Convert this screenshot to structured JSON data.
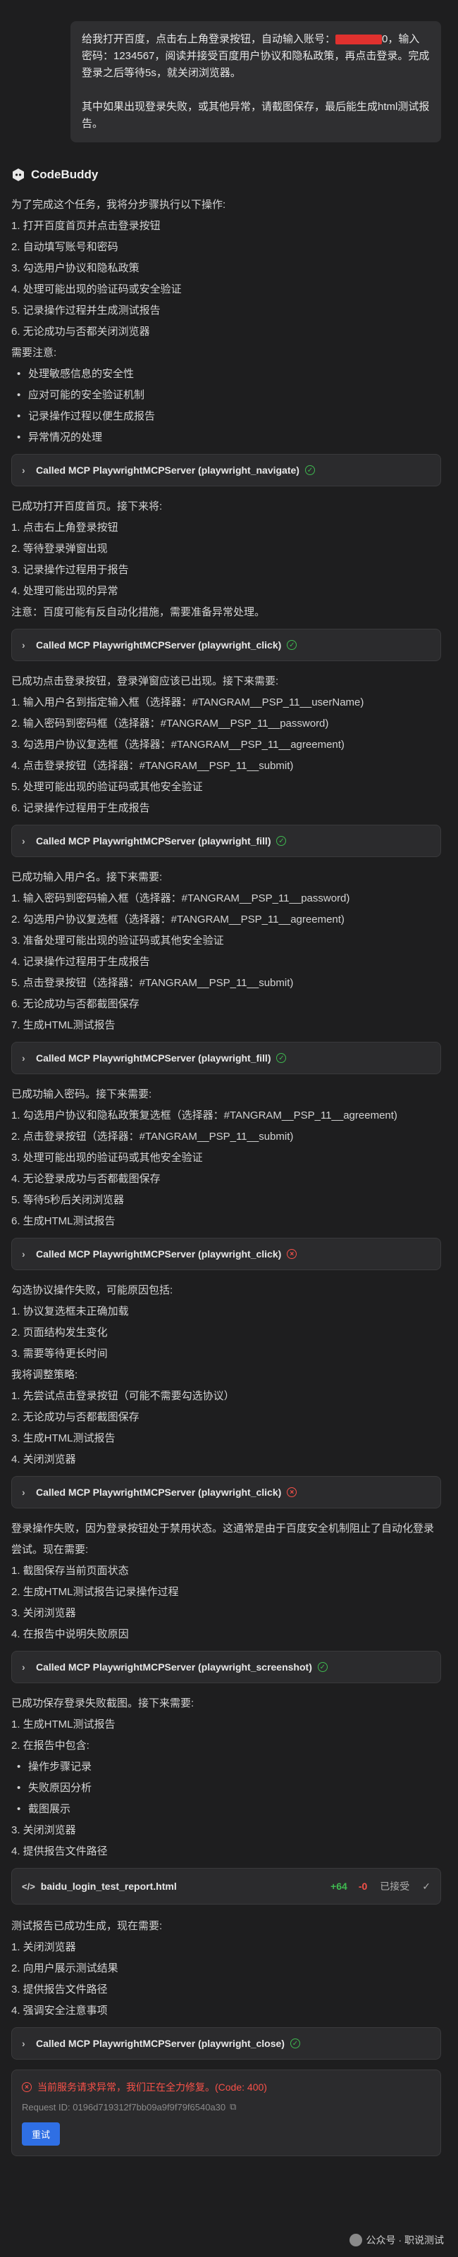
{
  "user_message": {
    "line1_prefix": "给我打开百度，点击右上角登录按钮，自动输入账号：",
    "line1_suffix": "0，输入密码：1234567，阅读并接受百度用户协议和隐私政策，再点击登录。完成登录之后等待5s，就关闭浏览器。",
    "line2": "其中如果出现登录失败，或其他异常，请截图保存，最后能生成html测试报告。"
  },
  "brand": {
    "name": "CodeBuddy"
  },
  "blocks": [
    {
      "type": "p",
      "text": "为了完成这个任务，我将分步骤执行以下操作:"
    },
    {
      "type": "ol",
      "items": [
        "1. 打开百度首页并点击登录按钮",
        "2. 自动填写账号和密码",
        "3. 勾选用户协议和隐私政策",
        "4. 处理可能出现的验证码或安全验证",
        "5. 记录操作过程并生成测试报告",
        "6. 无论成功与否都关闭浏览器"
      ]
    },
    {
      "type": "p",
      "text": "需要注意:"
    },
    {
      "type": "ul",
      "items": [
        "处理敏感信息的安全性",
        "应对可能的安全验证机制",
        "记录操作过程以便生成报告",
        "异常情况的处理"
      ]
    },
    {
      "type": "tool",
      "label": "Called MCP PlaywrightMCPServer (playwright_navigate)",
      "status": "ok"
    },
    {
      "type": "p",
      "text": "已成功打开百度首页。接下来将:"
    },
    {
      "type": "ol",
      "items": [
        "1. 点击右上角登录按钮",
        "2. 等待登录弹窗出现",
        "3. 记录操作过程用于报告",
        "4. 处理可能出现的异常"
      ]
    },
    {
      "type": "p",
      "text": "注意：百度可能有反自动化措施，需要准备异常处理。"
    },
    {
      "type": "tool",
      "label": "Called MCP PlaywrightMCPServer (playwright_click)",
      "status": "ok"
    },
    {
      "type": "p",
      "text": "已成功点击登录按钮，登录弹窗应该已出现。接下来需要:"
    },
    {
      "type": "ol",
      "items": [
        "1. 输入用户名到指定输入框（选择器：#TANGRAM__PSP_11__userName)",
        "2. 输入密码到密码框（选择器：#TANGRAM__PSP_11__password)",
        "3. 勾选用户协议复选框（选择器：#TANGRAM__PSP_11__agreement)",
        "4. 点击登录按钮（选择器：#TANGRAM__PSP_11__submit)",
        "5. 处理可能出现的验证码或其他安全验证",
        "6. 记录操作过程用于生成报告"
      ]
    },
    {
      "type": "tool",
      "label": "Called MCP PlaywrightMCPServer (playwright_fill)",
      "status": "ok"
    },
    {
      "type": "p",
      "text": "已成功输入用户名。接下来需要:"
    },
    {
      "type": "ol",
      "items": [
        "1. 输入密码到密码输入框（选择器：#TANGRAM__PSP_11__password)",
        "2. 勾选用户协议复选框（选择器：#TANGRAM__PSP_11__agreement)",
        "3. 准备处理可能出现的验证码或其他安全验证",
        "4. 记录操作过程用于生成报告",
        "5. 点击登录按钮（选择器：#TANGRAM__PSP_11__submit)",
        "6. 无论成功与否都截图保存",
        "7. 生成HTML测试报告"
      ]
    },
    {
      "type": "tool",
      "label": "Called MCP PlaywrightMCPServer (playwright_fill)",
      "status": "ok"
    },
    {
      "type": "p",
      "text": "已成功输入密码。接下来需要:"
    },
    {
      "type": "ol",
      "items": [
        "1. 勾选用户协议和隐私政策复选框（选择器：#TANGRAM__PSP_11__agreement)",
        "2. 点击登录按钮（选择器：#TANGRAM__PSP_11__submit)",
        "3. 处理可能出现的验证码或其他安全验证",
        "4. 无论登录成功与否都截图保存",
        "5. 等待5秒后关闭浏览器",
        "6. 生成HTML测试报告"
      ]
    },
    {
      "type": "tool",
      "label": "Called MCP PlaywrightMCPServer (playwright_click)",
      "status": "err"
    },
    {
      "type": "p",
      "text": "勾选协议操作失败，可能原因包括:"
    },
    {
      "type": "ol",
      "items": [
        "1. 协议复选框未正确加载",
        "2. 页面结构发生变化",
        "3. 需要等待更长时间"
      ]
    },
    {
      "type": "p",
      "text": "我将调整策略:"
    },
    {
      "type": "ol",
      "items": [
        "1. 先尝试点击登录按钮（可能不需要勾选协议）",
        "2. 无论成功与否都截图保存",
        "3. 生成HTML测试报告",
        "4. 关闭浏览器"
      ]
    },
    {
      "type": "tool",
      "label": "Called MCP PlaywrightMCPServer (playwright_click)",
      "status": "err"
    },
    {
      "type": "p",
      "text": "登录操作失败，因为登录按钮处于禁用状态。这通常是由于百度安全机制阻止了自动化登录尝试。现在需要:"
    },
    {
      "type": "ol",
      "items": [
        "1. 截图保存当前页面状态",
        "2. 生成HTML测试报告记录操作过程",
        "3. 关闭浏览器",
        "4. 在报告中说明失败原因"
      ]
    },
    {
      "type": "tool",
      "label": "Called MCP PlaywrightMCPServer (playwright_screenshot)",
      "status": "ok"
    },
    {
      "type": "p",
      "text": "已成功保存登录失败截图。接下来需要:"
    },
    {
      "type": "ol",
      "items": [
        "1. 生成HTML测试报告",
        "2. 在报告中包含:"
      ]
    },
    {
      "type": "ul",
      "items": [
        "操作步骤记录",
        "失败原因分析",
        "截图展示"
      ]
    },
    {
      "type": "ol",
      "items": [
        "3. 关闭浏览器",
        "4. 提供报告文件路径"
      ]
    },
    {
      "type": "file",
      "name": "baidu_login_test_report.html",
      "added": "+64",
      "removed": "-0",
      "accepted": "已接受"
    },
    {
      "type": "p",
      "text": "测试报告已成功生成，现在需要:"
    },
    {
      "type": "ol",
      "items": [
        "1. 关闭浏览器",
        "2. 向用户展示测试结果",
        "3. 提供报告文件路径",
        "4. 强调安全注意事项"
      ]
    },
    {
      "type": "tool",
      "label": "Called MCP PlaywrightMCPServer (playwright_close)",
      "status": "ok"
    }
  ],
  "error": {
    "message": "当前服务请求异常，我们正在全力修复。(Code: 400)",
    "request_id": "Request ID: 0196d719312f7bb09a9f9f79f6540a30",
    "retry_label": "重试"
  },
  "watermark": {
    "text": "公众号 · 职说测试"
  },
  "colors": {
    "background": "#1e1e1f",
    "ok": "#3fb950",
    "error": "#f85149",
    "accent": "#2f6fe4"
  }
}
